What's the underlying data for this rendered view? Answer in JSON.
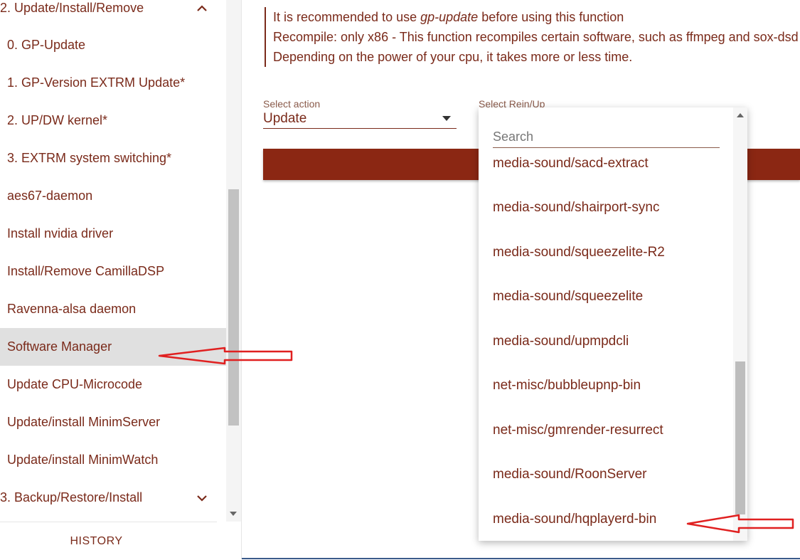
{
  "sidebar": {
    "items": [
      {
        "label": "2. Update/Install/Remove",
        "section": true,
        "expanded": true
      },
      {
        "label": "0. GP-Update"
      },
      {
        "label": "1. GP-Version EXTRM Update*"
      },
      {
        "label": "2. UP/DW kernel*"
      },
      {
        "label": "3. EXTRM system switching*"
      },
      {
        "label": "aes67-daemon"
      },
      {
        "label": "Install nvidia driver"
      },
      {
        "label": "Install/Remove CamillaDSP"
      },
      {
        "label": "Ravenna-alsa daemon"
      },
      {
        "label": "Software Manager",
        "selected": true
      },
      {
        "label": "Update CPU-Microcode"
      },
      {
        "label": "Update/install MinimServer"
      },
      {
        "label": "Update/install MinimWatch"
      },
      {
        "label": "3. Backup/Restore/Install",
        "section": true,
        "expanded": false
      }
    ],
    "history_label": "HISTORY"
  },
  "info": {
    "line1_prefix": "It is recommended to use ",
    "line1_emphasis": "gp-update",
    "line1_suffix": " before using this function",
    "line2": "Recompile: only x86 - This function recompiles certain software, such as ffmpeg and sox-dsd",
    "line3": "Depending on the power of your cpu, it takes more or less time."
  },
  "form": {
    "select_action_label": "Select action",
    "select_action_value": "Update",
    "select_rein_label": "Select Rein/Up"
  },
  "dropdown": {
    "search_placeholder": "Search",
    "options": [
      "media-sound/sacd-extract",
      "media-sound/shairport-sync",
      "media-sound/squeezelite-R2",
      "media-sound/squeezelite",
      "media-sound/upmpdcli",
      "net-misc/bubbleupnp-bin",
      "net-misc/gmrender-resurrect",
      "media-sound/RoonServer",
      "media-sound/hqplayerd-bin"
    ]
  },
  "colors": {
    "accent": "#8b2713",
    "text": "#7a2a1a",
    "annotation": "#e02020"
  }
}
